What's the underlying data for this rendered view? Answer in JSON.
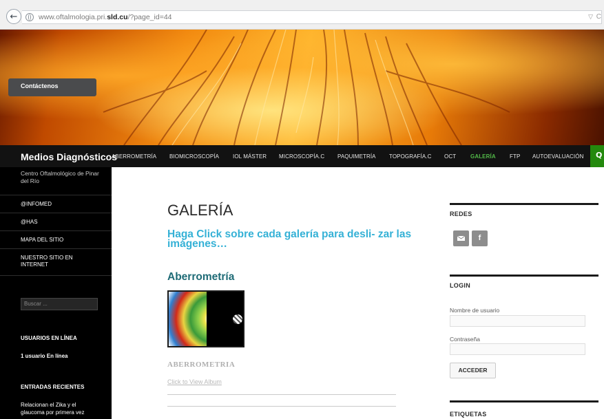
{
  "browser": {
    "url_prefix": "www.oftalmologia.pri.",
    "url_domain": "sld.cu",
    "url_path": "/?page_id=44",
    "back_icon": "back-arrow-icon",
    "dropdown_glyph": "▽",
    "reload_glyph": "C"
  },
  "header": {
    "contact_label": "Contáctenos"
  },
  "nav": {
    "site_title": "Medios Diagnósticos",
    "items": [
      {
        "label": "ABERROMETRÍA"
      },
      {
        "label": "BIOMICROSCOPÍA"
      },
      {
        "label": "IOL MÁSTER"
      },
      {
        "label": "MICROSCOPÍA.C"
      },
      {
        "label": "PAQUIMETRÍA"
      },
      {
        "label": "TOPOGRAFÍA.C"
      },
      {
        "label": "OCT"
      },
      {
        "label": "GALERÍA"
      },
      {
        "label": "FTP"
      },
      {
        "label": "AUTOEVALUACIÓN"
      }
    ],
    "active_color": "#52b848",
    "search_color": "#24890d"
  },
  "sidebar": {
    "description": "Centro Oftalmológico de Pinar del Río",
    "links": [
      {
        "label": "@INFOMED"
      },
      {
        "label": "@HAS"
      },
      {
        "label": "MAPA DEL SITIO"
      },
      {
        "label": "NUESTRO SITIO EN INTERNET"
      }
    ],
    "search_placeholder": "Buscar ...",
    "users_heading": "USUARIOS EN LÍNEA",
    "users_text": "1 usuario En línea",
    "recent_heading": "ENTRADAS RECIENTES",
    "recent_post": "Relacionan el Zika y el glaucoma por primera vez"
  },
  "main": {
    "title": "GALERÍA",
    "intro": "Haga Click sobre cada galería para desli- zar las imágenes…",
    "gallery_title": "Aberrometría",
    "album_name": "ABERROMETRIA",
    "album_link": "Click to View Album"
  },
  "widgets": {
    "redes_title": "REDES",
    "mail_icon": "mail-icon",
    "facebook_glyph": "f",
    "login_title": "LOGIN",
    "username_label": "Nombre de usuario",
    "password_label": "Contraseña",
    "submit_label": "ACCEDER",
    "tags_title": "ETIQUETAS"
  }
}
